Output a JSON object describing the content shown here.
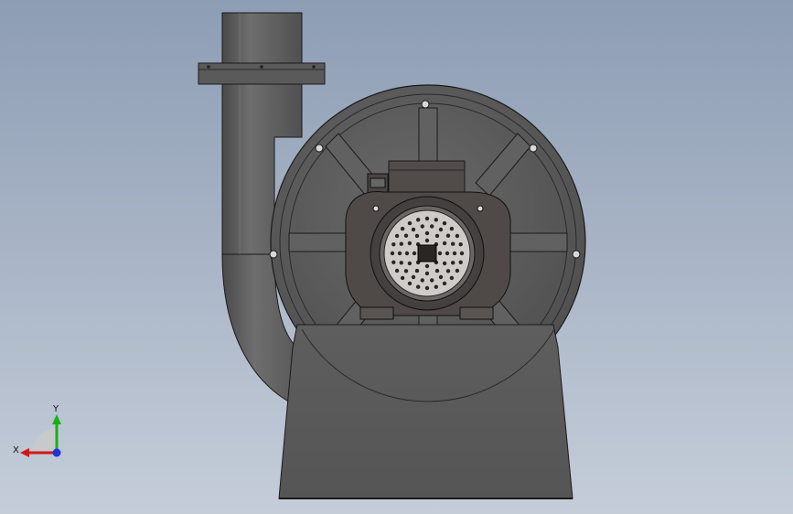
{
  "viewport": {
    "background_top": "#8d9db4",
    "background_bottom": "#c5cdd9"
  },
  "model": {
    "body_color": "#5c5c5c",
    "edge_color": "#1a1a1a",
    "highlight_color": "#7a7a7a",
    "motor_color": "#4f4a48"
  },
  "triad": {
    "x_label": "X",
    "y_label": "Y",
    "x_color": "#d01818",
    "y_color": "#18b018",
    "z_color": "#1a35e0"
  }
}
